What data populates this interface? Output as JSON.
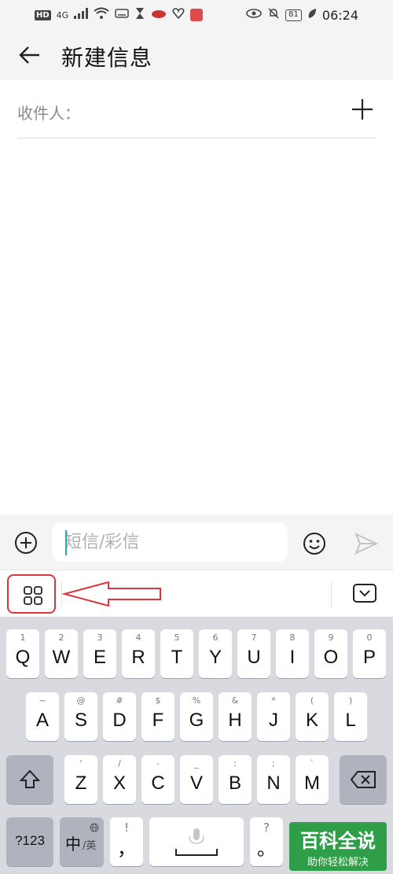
{
  "status_bar": {
    "hd": "HD",
    "network": "4G",
    "battery": "81",
    "time": "06:24"
  },
  "header": {
    "title": "新建信息"
  },
  "recipient": {
    "label": "收件人："
  },
  "compose": {
    "placeholder": "短信/彩信"
  },
  "keyboard": {
    "row1": [
      {
        "hint": "1",
        "char": "Q"
      },
      {
        "hint": "2",
        "char": "W"
      },
      {
        "hint": "3",
        "char": "E"
      },
      {
        "hint": "4",
        "char": "R"
      },
      {
        "hint": "5",
        "char": "T"
      },
      {
        "hint": "6",
        "char": "Y"
      },
      {
        "hint": "7",
        "char": "U"
      },
      {
        "hint": "8",
        "char": "I"
      },
      {
        "hint": "9",
        "char": "O"
      },
      {
        "hint": "0",
        "char": "P"
      }
    ],
    "row2": [
      {
        "hint": "~",
        "char": "A"
      },
      {
        "hint": "@",
        "char": "S"
      },
      {
        "hint": "#",
        "char": "D"
      },
      {
        "hint": "$",
        "char": "F"
      },
      {
        "hint": "%",
        "char": "G"
      },
      {
        "hint": "&",
        "char": "H"
      },
      {
        "hint": "*",
        "char": "J"
      },
      {
        "hint": "(",
        "char": "K"
      },
      {
        "hint": ")",
        "char": "L"
      }
    ],
    "row3": [
      {
        "hint": "'",
        "char": "Z"
      },
      {
        "hint": "/",
        "char": "X"
      },
      {
        "hint": "-",
        "char": "C"
      },
      {
        "hint": "_",
        "char": "V"
      },
      {
        "hint": ":",
        "char": "B"
      },
      {
        "hint": ";",
        "char": "N"
      },
      {
        "hint": "`",
        "char": "M"
      }
    ],
    "symbols_label": "?123",
    "lang_main": "中",
    "lang_sub": "/英",
    "punct_hint": "!",
    "punct_char": "，",
    "period_hint": "?",
    "period_char": "。"
  },
  "watermark": {
    "main": "百科全说",
    "sub": "助你轻松解决"
  },
  "colors": {
    "highlight_red": "#d9373f",
    "caret_teal": "#2aa6b0",
    "watermark_green": "#2f9e49"
  }
}
